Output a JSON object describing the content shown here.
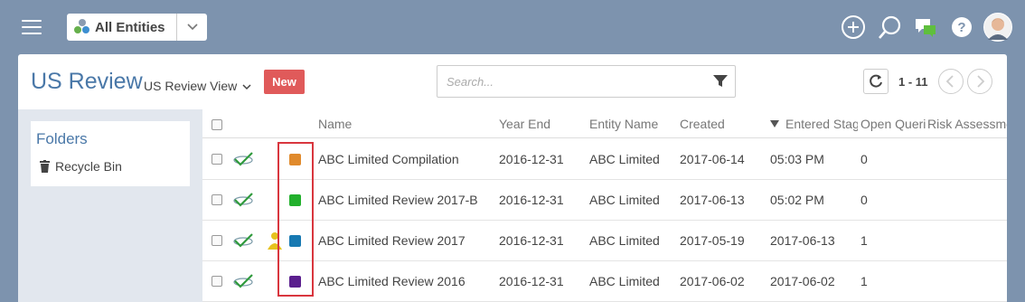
{
  "header": {
    "entity_selector": "All Entities"
  },
  "panel": {
    "title": "US Review",
    "view_label": "US Review View",
    "new_label": "New",
    "search_placeholder": "Search...",
    "pager_label": "1 - 11"
  },
  "sidebar": {
    "folders_title": "Folders",
    "recycle_label": "Recycle Bin"
  },
  "table": {
    "columns": {
      "name": "Name",
      "year_end": "Year End",
      "entity_name": "Entity Name",
      "created": "Created",
      "entered_stage": "Entered Stage",
      "open_queries": "Open Queries",
      "risk_assessment": "Risk Assessment"
    },
    "rows": [
      {
        "name": "ABC Limited Compilation",
        "year_end": "2016-12-31",
        "entity": "ABC Limited",
        "created": "2017-06-14",
        "entered_stage": "05:03 PM",
        "open_queries": "0",
        "status_color": "#e08a2c",
        "has_person": false
      },
      {
        "name": "ABC Limited Review 2017-B",
        "year_end": "2016-12-31",
        "entity": "ABC Limited",
        "created": "2017-06-13",
        "entered_stage": "05:02 PM",
        "open_queries": "0",
        "status_color": "#22b02c",
        "has_person": false
      },
      {
        "name": "ABC Limited Review 2017",
        "year_end": "2016-12-31",
        "entity": "ABC Limited",
        "created": "2017-05-19",
        "entered_stage": "2017-06-13",
        "open_queries": "1",
        "status_color": "#1779b2",
        "has_person": true
      },
      {
        "name": "ABC Limited Review 2016",
        "year_end": "2016-12-31",
        "entity": "ABC Limited",
        "created": "2017-06-02",
        "entered_stage": "2017-06-02",
        "open_queries": "1",
        "status_color": "#5b1f8e",
        "has_person": false
      }
    ]
  },
  "colors": {
    "background": "#7d93ae",
    "accent_blue": "#4a78a8",
    "new_button": "#e05a5a",
    "highlight_border": "#d9363e"
  },
  "icons": [
    "menu-icon",
    "chevron-down-icon",
    "plus-circle-icon",
    "search-icon",
    "chat-icon",
    "help-icon",
    "avatar",
    "filter-icon",
    "refresh-icon",
    "chevron-left-icon",
    "chevron-right-icon",
    "trash-icon",
    "sort-desc-icon",
    "checkmark-logo-icon",
    "person-icon"
  ]
}
